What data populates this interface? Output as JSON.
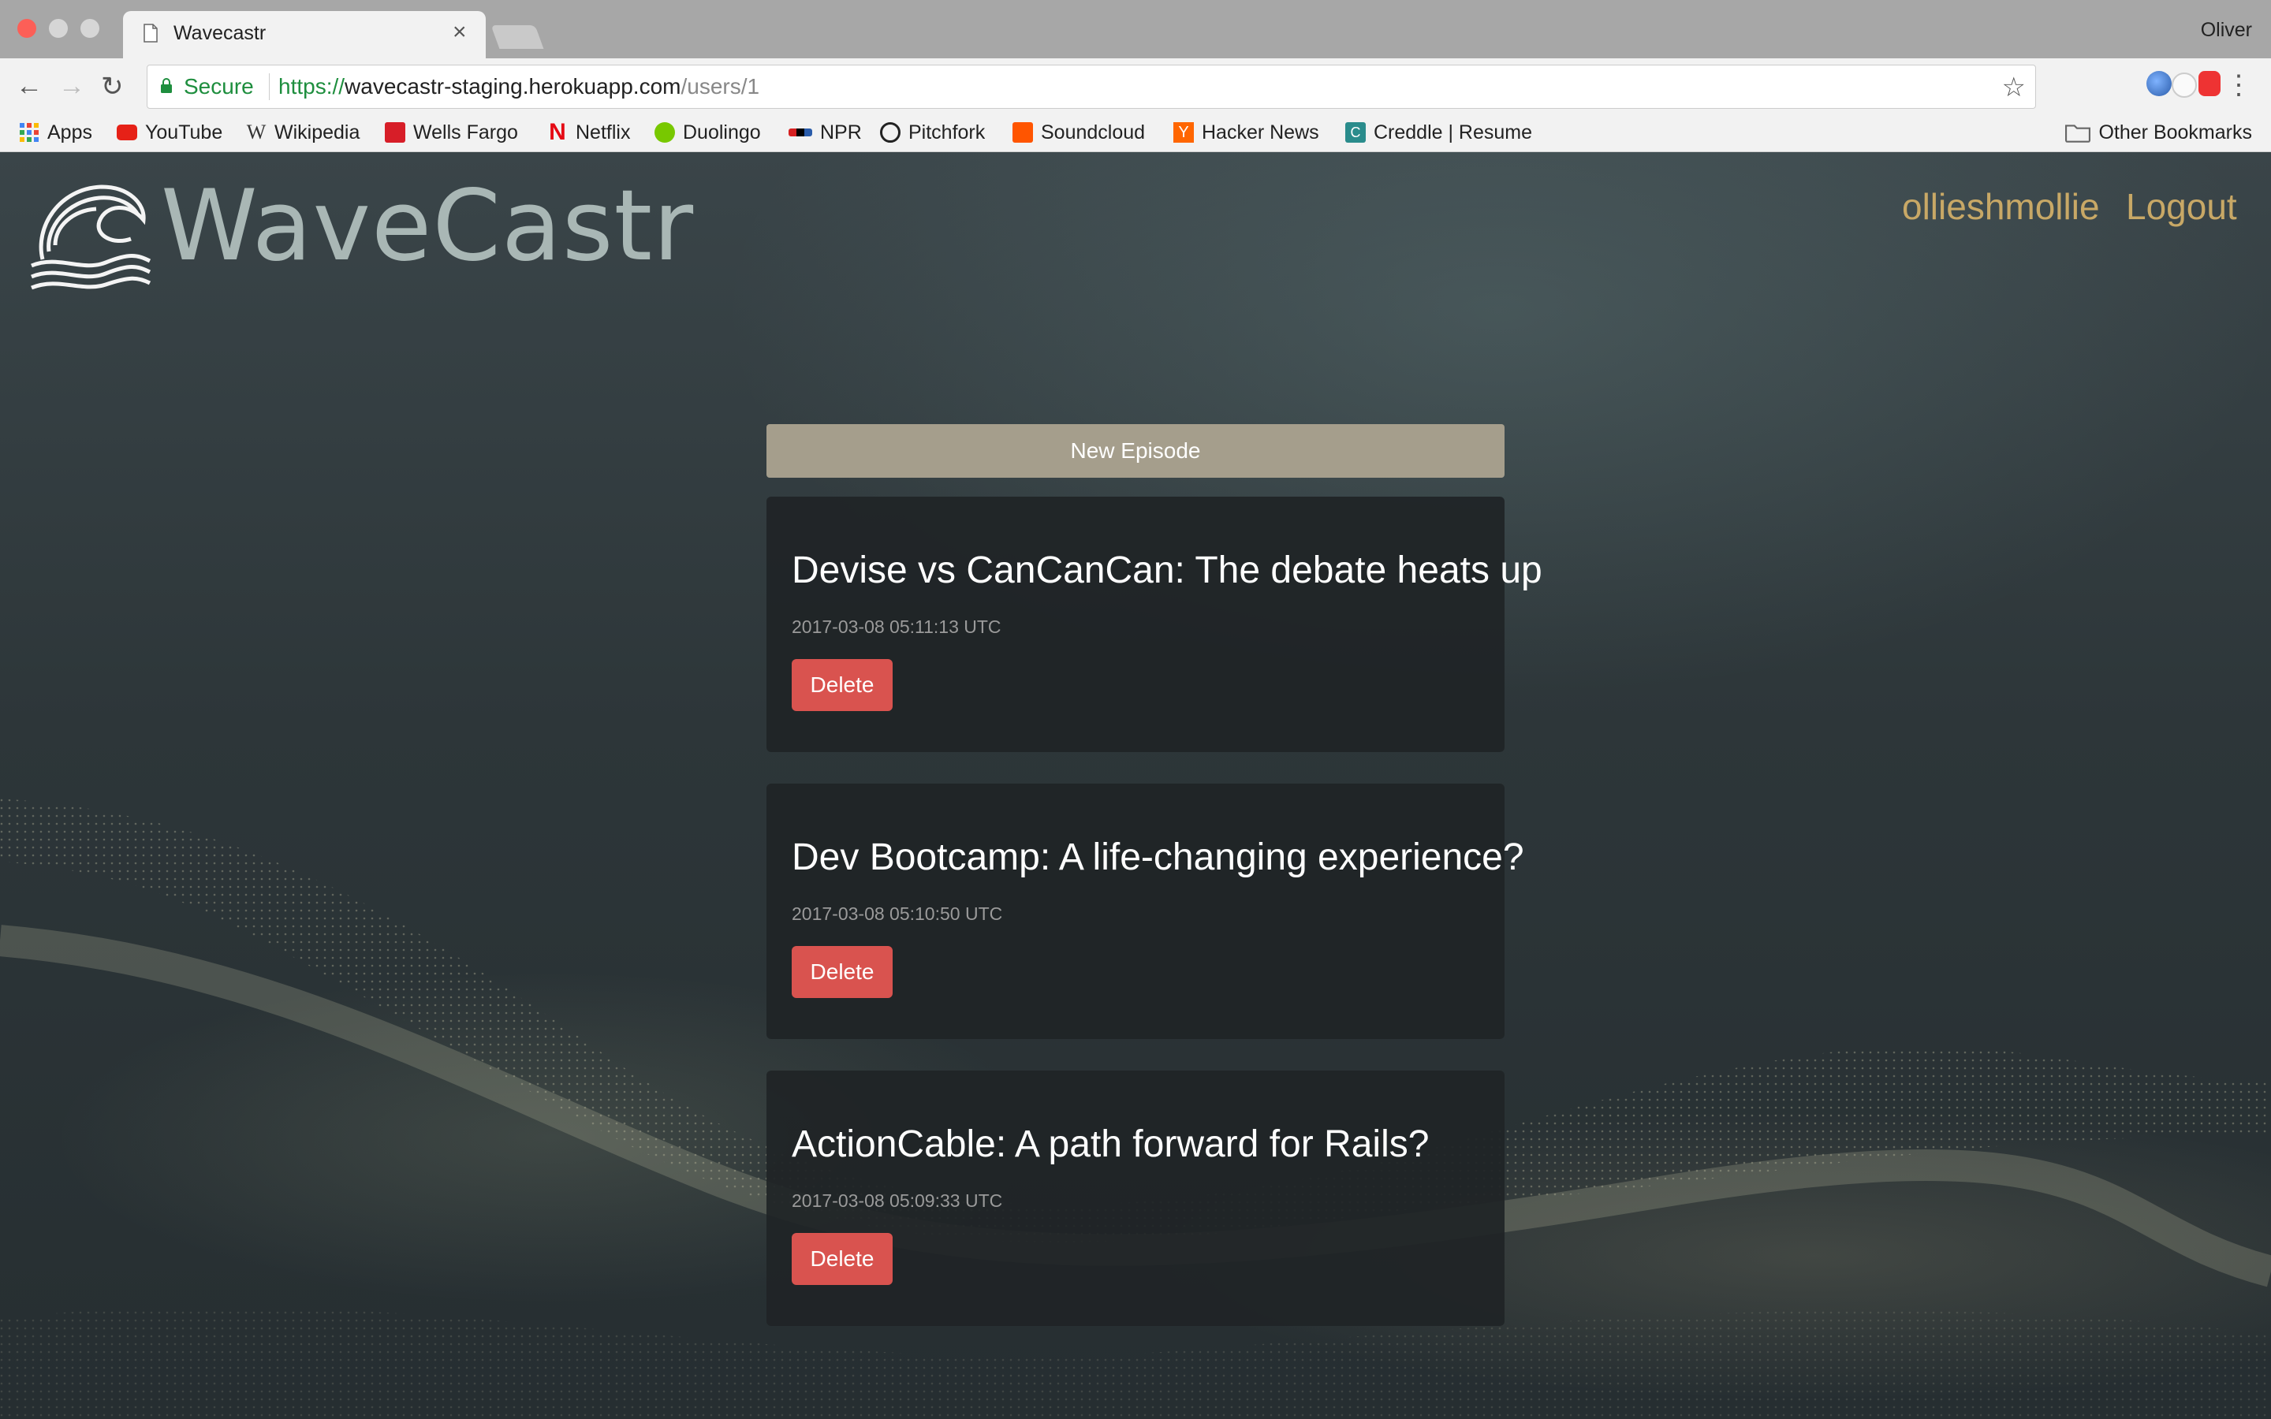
{
  "browser": {
    "tab_title": "Wavecastr",
    "profile_name": "Oliver",
    "secure_label": "Secure",
    "url_scheme": "https://",
    "url_host": "wavecastr-staging.herokuapp.com",
    "url_path": "/users/1",
    "bookmarks": [
      {
        "label": "Apps",
        "icon": "apps-grid-icon",
        "color": "#4285f4"
      },
      {
        "label": "YouTube",
        "icon": "youtube-icon",
        "color": "#e62117"
      },
      {
        "label": "Wikipedia",
        "icon": "wikipedia-icon",
        "color": "#333333"
      },
      {
        "label": "Wells Fargo",
        "icon": "wells-fargo-icon",
        "color": "#d71e28"
      },
      {
        "label": "Netflix",
        "icon": "netflix-icon",
        "color": "#e50914"
      },
      {
        "label": "Duolingo",
        "icon": "duolingo-icon",
        "color": "#78c800"
      },
      {
        "label": "NPR",
        "icon": "npr-icon",
        "color": "#2a5caa"
      },
      {
        "label": "Pitchfork",
        "icon": "pitchfork-icon",
        "color": "#222222"
      },
      {
        "label": "Soundcloud",
        "icon": "soundcloud-icon",
        "color": "#ff5500"
      },
      {
        "label": "Hacker News",
        "icon": "hacker-news-icon",
        "color": "#ff6600"
      },
      {
        "label": "Creddle | Resume",
        "icon": "creddle-icon",
        "color": "#2a8c8c"
      }
    ],
    "other_bookmarks": "Other Bookmarks"
  },
  "site": {
    "brand": "WaveCastr",
    "nav": {
      "username": "ollieshmollie",
      "logout": "Logout"
    },
    "new_episode_label": "New Episode",
    "episodes": [
      {
        "title": "Devise vs CanCanCan: The debate heats up",
        "date": "2017-03-08 05:11:13 UTC",
        "delete_label": "Delete"
      },
      {
        "title": "Dev Bootcamp: A life-changing experience?",
        "date": "2017-03-08 05:10:50 UTC",
        "delete_label": "Delete"
      },
      {
        "title": "ActionCable: A path forward for Rails?",
        "date": "2017-03-08 05:09:33 UTC",
        "delete_label": "Delete"
      }
    ]
  },
  "colors": {
    "accent_link": "#c8a866",
    "delete": "#d9534f",
    "new_episode": "#a59e8c",
    "brand_text": "#a9b7b5"
  }
}
